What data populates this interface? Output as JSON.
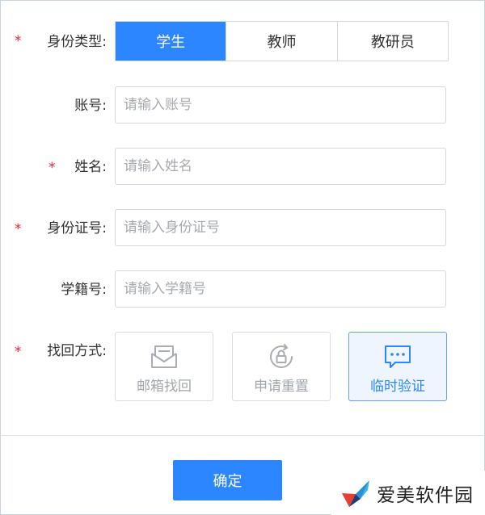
{
  "form": {
    "identity_type": {
      "label": "身份类型:",
      "options": [
        "学生",
        "教师",
        "教研员"
      ],
      "selected": "学生"
    },
    "account": {
      "label": "账号:",
      "placeholder": "请输入账号"
    },
    "name": {
      "label": "姓名:",
      "placeholder": "请输入姓名"
    },
    "id_number": {
      "label": "身份证号:",
      "placeholder": "请输入身份证号"
    },
    "student_number": {
      "label": "学籍号:",
      "placeholder": "请输入学籍号"
    },
    "recovery_method": {
      "label": "找回方式:",
      "options": [
        {
          "label": "邮箱找回",
          "icon": "envelope-icon"
        },
        {
          "label": "申请重置",
          "icon": "reset-lock-icon"
        },
        {
          "label": "临时验证",
          "icon": "chat-bubble-icon"
        }
      ],
      "selected": "临时验证"
    },
    "required_mark": "*",
    "submit_label": "确定"
  },
  "watermark": {
    "text": "爱美软件园"
  },
  "colors": {
    "accent": "#2b86ff",
    "required": "#f5222d",
    "border": "#d5d9df"
  }
}
